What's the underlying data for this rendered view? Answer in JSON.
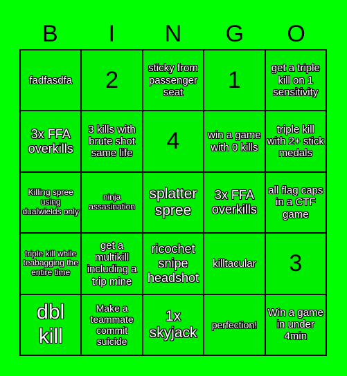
{
  "header": {
    "letters": [
      "B",
      "I",
      "N",
      "G",
      "O"
    ]
  },
  "board": {
    "colors": {
      "background": "#00ff00",
      "cell": "#00ee00",
      "grid_line": "#000000"
    },
    "rows": [
      [
        {
          "text": "fadfasdfa"
        },
        {
          "text": "2"
        },
        {
          "text": "sticky from passenger seat"
        },
        {
          "text": "1"
        },
        {
          "text": "get a triple kill on 1 sensitivity"
        }
      ],
      [
        {
          "text": "3x FFA overkills"
        },
        {
          "text": "3 kills with brute shot same life"
        },
        {
          "text": "4"
        },
        {
          "text": "win a game with 0 kills"
        },
        {
          "text": "triple kill with 2+ stick medals"
        }
      ],
      [
        {
          "text": "Killing spree using dualwields only"
        },
        {
          "text": "ninja assasination"
        },
        {
          "text": "splatter spree"
        },
        {
          "text": "3x FFA overkills"
        },
        {
          "text": "all flag caps in a CTF game"
        }
      ],
      [
        {
          "text": "triple kill while teabagging the entire time"
        },
        {
          "text": "get a multikill including a trip mine"
        },
        {
          "text": "ricochet snipe headshot"
        },
        {
          "text": "killtacular"
        },
        {
          "text": "3"
        }
      ],
      [
        {
          "text": "dbl kill"
        },
        {
          "text": "Make a teammate commit suicide"
        },
        {
          "text": "1x skyjack"
        },
        {
          "text": "perfection!"
        },
        {
          "text": "Win a game in under 4min"
        }
      ]
    ]
  }
}
